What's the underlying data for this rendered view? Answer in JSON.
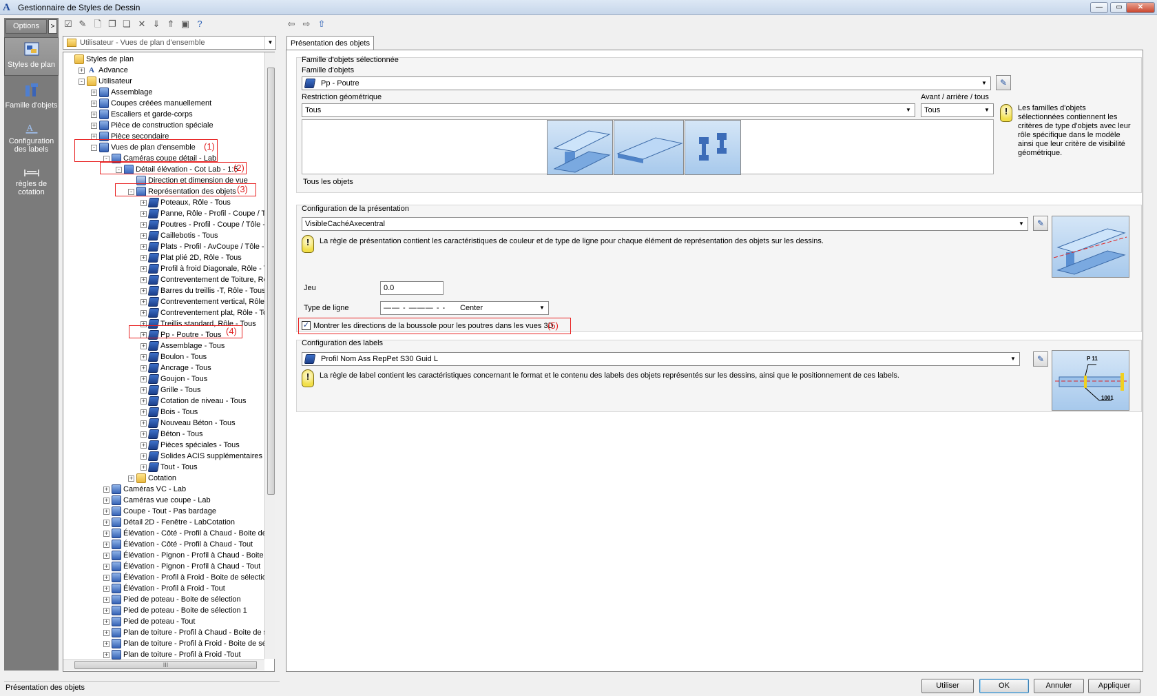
{
  "window": {
    "title": "Gestionnaire de Styles de Dessin",
    "app_icon": "A",
    "min": "—",
    "max": "▭",
    "close": "✕"
  },
  "sidebar": {
    "options_label": "Options",
    "options_arrow": ">",
    "items": [
      {
        "label": "Styles de plan",
        "icon": "styles-de-plan-icon"
      },
      {
        "label": "Famille d'objets",
        "icon": "famille-objets-icon"
      },
      {
        "label": "Configuration des labels",
        "icon": "configuration-labels-icon"
      },
      {
        "label": "règles de cotation",
        "icon": "regles-cotation-icon"
      }
    ]
  },
  "toolbar": {
    "nav_back": "⇦",
    "nav_forward": "⇨",
    "nav_up": "⇧"
  },
  "tree_panel": {
    "combo_value": "Utilisateur - Vues de plan d'ensemble",
    "scroll_h_thumb_label": "III",
    "nodes": [
      {
        "label": "Styles de plan",
        "toggle": "",
        "icon": "folder"
      },
      {
        "label": "Advance",
        "toggle": "+",
        "icon": "A"
      },
      {
        "label": "Utilisateur",
        "toggle": "-",
        "icon": "folder"
      },
      {
        "label": "Assemblage",
        "toggle": "+",
        "icon": "style"
      },
      {
        "label": "Coupes créées manuellement",
        "toggle": "+",
        "icon": "style"
      },
      {
        "label": "Escaliers et garde-corps",
        "toggle": "+",
        "icon": "style"
      },
      {
        "label": "Pièce de construction spéciale",
        "toggle": "+",
        "icon": "style"
      },
      {
        "label": "Pièce secondaire",
        "toggle": "+",
        "icon": "style"
      },
      {
        "label": "Vues de plan d'ensemble",
        "toggle": "-",
        "icon": "style"
      },
      {
        "label": "Caméras coupe détail - Lab",
        "toggle": "-",
        "icon": "style"
      },
      {
        "label": "Détail élévation - Cot Lab - 1:5",
        "toggle": "-",
        "icon": "cube"
      },
      {
        "label": "Direction et dimension de vue",
        "toggle": "",
        "icon": "nav"
      },
      {
        "label": "Représentation des objets",
        "toggle": "-",
        "icon": "style"
      },
      {
        "label": "Poteaux, Rôle - Tous",
        "toggle": "+",
        "icon": "rule"
      },
      {
        "label": "Panne, Rôle - Profil - Coupe / Tôle",
        "toggle": "+",
        "icon": "rule"
      },
      {
        "label": "Poutres - Profil - Coupe / Tôle - Ep",
        "toggle": "+",
        "icon": "rule"
      },
      {
        "label": "Caillebotis - Tous",
        "toggle": "+",
        "icon": "rule"
      },
      {
        "label": "Plats - Profil - AvCoupe / Tôle - Ep",
        "toggle": "+",
        "icon": "rule"
      },
      {
        "label": "Plat plié 2D, Rôle - Tous",
        "toggle": "+",
        "icon": "rule"
      },
      {
        "label": "Profil à froid Diagonale, Rôle - Tous",
        "toggle": "+",
        "icon": "rule"
      },
      {
        "label": "Contreventement de Toiture, Rôle ",
        "toggle": "+",
        "icon": "rule"
      },
      {
        "label": "Barres du treillis -T, Rôle - Tous",
        "toggle": "+",
        "icon": "rule"
      },
      {
        "label": "Contreventement vertical, Rôle - T",
        "toggle": "+",
        "icon": "rule"
      },
      {
        "label": "Contreventement plat, Rôle - Tous",
        "toggle": "+",
        "icon": "rule"
      },
      {
        "label": "Treillis standard, Rôle - Tous",
        "toggle": "+",
        "icon": "rule"
      },
      {
        "label": "Pp - Poutre - Tous",
        "toggle": "+",
        "icon": "rule"
      },
      {
        "label": "Assemblage - Tous",
        "toggle": "+",
        "icon": "rule"
      },
      {
        "label": "Boulon - Tous",
        "toggle": "+",
        "icon": "rule"
      },
      {
        "label": "Ancrage - Tous",
        "toggle": "+",
        "icon": "rule"
      },
      {
        "label": "Goujon - Tous",
        "toggle": "+",
        "icon": "rule"
      },
      {
        "label": "Grille - Tous",
        "toggle": "+",
        "icon": "rule"
      },
      {
        "label": "Cotation de niveau - Tous",
        "toggle": "+",
        "icon": "rule"
      },
      {
        "label": "Bois - Tous",
        "toggle": "+",
        "icon": "rule"
      },
      {
        "label": "Nouveau Béton - Tous",
        "toggle": "+",
        "icon": "rule"
      },
      {
        "label": "Béton - Tous",
        "toggle": "+",
        "icon": "rule"
      },
      {
        "label": "Pièces spéciales - Tous",
        "toggle": "+",
        "icon": "rule"
      },
      {
        "label": "Solides ACIS supplémentaires - To",
        "toggle": "+",
        "icon": "rule"
      },
      {
        "label": "Tout - Tous",
        "toggle": "+",
        "icon": "rule"
      },
      {
        "label": "Cotation",
        "toggle": "+",
        "icon": "folder"
      },
      {
        "label": "Caméras VC - Lab",
        "toggle": "+",
        "icon": "style"
      },
      {
        "label": "Caméras vue coupe - Lab",
        "toggle": "+",
        "icon": "style"
      },
      {
        "label": "Coupe - Tout - Pas bardage",
        "toggle": "+",
        "icon": "style"
      },
      {
        "label": "Détail 2D - Fenêtre - LabCotation",
        "toggle": "+",
        "icon": "style"
      },
      {
        "label": "Élévation - Côté - Profil à Chaud - Boite de séle",
        "toggle": "+",
        "icon": "style"
      },
      {
        "label": "Élévation - Côté - Profil à Chaud - Tout",
        "toggle": "+",
        "icon": "style"
      },
      {
        "label": "Élévation - Pignon - Profil à Chaud - Boite de s",
        "toggle": "+",
        "icon": "style"
      },
      {
        "label": "Élévation - Pignon - Profil à Chaud - Tout",
        "toggle": "+",
        "icon": "style"
      },
      {
        "label": "Élévation - Profil à Froid - Boite de sélection",
        "toggle": "+",
        "icon": "style"
      },
      {
        "label": "Élévation - Profil à Froid - Tout",
        "toggle": "+",
        "icon": "style"
      },
      {
        "label": "Pied de poteau - Boite de sélection",
        "toggle": "+",
        "icon": "style"
      },
      {
        "label": "Pied de poteau - Boite de sélection 1",
        "toggle": "+",
        "icon": "style"
      },
      {
        "label": "Pied de poteau - Tout",
        "toggle": "+",
        "icon": "style"
      },
      {
        "label": "Plan de toiture - Profil à Chaud - Boite de sélec",
        "toggle": "+",
        "icon": "style"
      },
      {
        "label": "Plan de toiture - Profil à Froid - Boite de sélecti",
        "toggle": "+",
        "icon": "style"
      },
      {
        "label": "Plan de toiture - Profil à Froid -Tout",
        "toggle": "+",
        "icon": "style"
      }
    ],
    "annotations": [
      "(1)",
      "(2)",
      "(3)",
      "(4)",
      "(5)"
    ]
  },
  "tab": {
    "label": "Présentation des objets"
  },
  "famille": {
    "group_title": "Famille d'objets sélectionnée",
    "famille_label": "Famille d'objets",
    "famille_value": "Pp - Poutre",
    "restriction_label": "Restriction géométrique",
    "restriction_value": "Tous",
    "avant_label": "Avant / arrière / tous",
    "avant_value": "Tous",
    "preview_caption": "Tous les objets",
    "info": "Les familles d'objets sélectionnées contiennent les critères de type d'objets avec leur rôle spécifique dans le modèle ainsi que leur critère de visibilité géométrique."
  },
  "presentation": {
    "group_title": "Configuration de la présentation",
    "value": "VisibleCachéAxecentral",
    "info": "La règle de présentation contient les caractéristiques de couleur et de type de ligne pour chaque élément de représentation des objets sur les dessins.",
    "jeu_label": "Jeu",
    "jeu_value": "0.0",
    "type_ligne_label": "Type de ligne",
    "type_ligne_pattern": "—— - ——— - -",
    "type_ligne_value": "Center",
    "checkbox_label": "Montrer les directions de la boussole pour les poutres dans les vues 3D",
    "checkbox_mark": "✓"
  },
  "labels": {
    "group_title": "Configuration des labels",
    "value": "Profil Nom Ass RepPet S30 Guid L",
    "info": "La règle de label contient les caractéristiques concernant le format et le contenu des labels des objets représentés sur les dessins, ainsi que le positionnement de ces labels.",
    "preview_top": "P 11",
    "preview_bottom": "1001"
  },
  "footer": {
    "status": "Présentation des objets",
    "utiliser": "Utiliser",
    "ok": "OK",
    "annuler": "Annuler",
    "appliquer": "Appliquer"
  },
  "colors": {
    "highlight": "#e82020",
    "sidebar": "#7b7b7b",
    "preview": "#a7c9ec"
  }
}
